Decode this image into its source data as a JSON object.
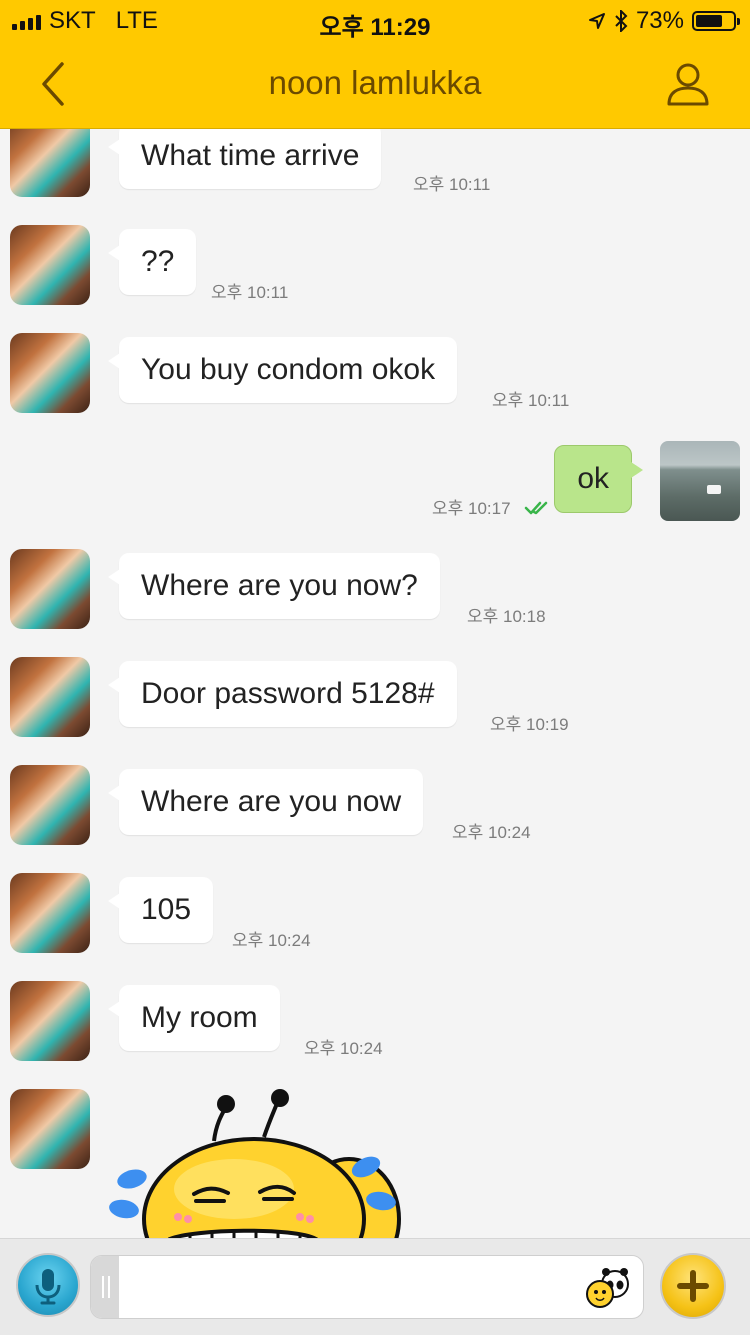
{
  "status_bar": {
    "carrier": "SKT",
    "network": "LTE",
    "time": "오후 11:29",
    "battery": "73%",
    "battery_level": 0.73
  },
  "header": {
    "title": "noon lamlukka"
  },
  "messages": [
    {
      "from": "them",
      "text": "What time arrive",
      "time": "오후 10:11"
    },
    {
      "from": "them",
      "text": "??",
      "time": "오후 10:11"
    },
    {
      "from": "them",
      "text": "You buy condom okok",
      "time": "오후 10:11"
    },
    {
      "from": "me",
      "text": "ok",
      "time": "오후 10:17",
      "status": "read-check-icon"
    },
    {
      "from": "them",
      "text": "Where are you now?",
      "time": "오후 10:18"
    },
    {
      "from": "them",
      "text": "Door password 5128#",
      "time": "오후 10:19"
    },
    {
      "from": "them",
      "text": "Where are you now",
      "time": "오후 10:24"
    },
    {
      "from": "them",
      "text": "105",
      "time": "오후 10:24"
    },
    {
      "from": "them",
      "text": "My room",
      "time": "오후 10:24"
    },
    {
      "from": "them",
      "sticker": "crying-laughing-bee-sticker"
    }
  ],
  "input": {
    "placeholder": "",
    "value": ""
  },
  "icons": {
    "back": "chevron-left-icon",
    "profile": "person-icon",
    "mic": "microphone-icon",
    "emoticon": "emoticon-icon",
    "plus": "plus-icon"
  },
  "colors": {
    "header": "#ffc900",
    "my_bubble": "#b9e58b",
    "their_bubble": "#ffffff",
    "background": "#f4f4f4"
  }
}
